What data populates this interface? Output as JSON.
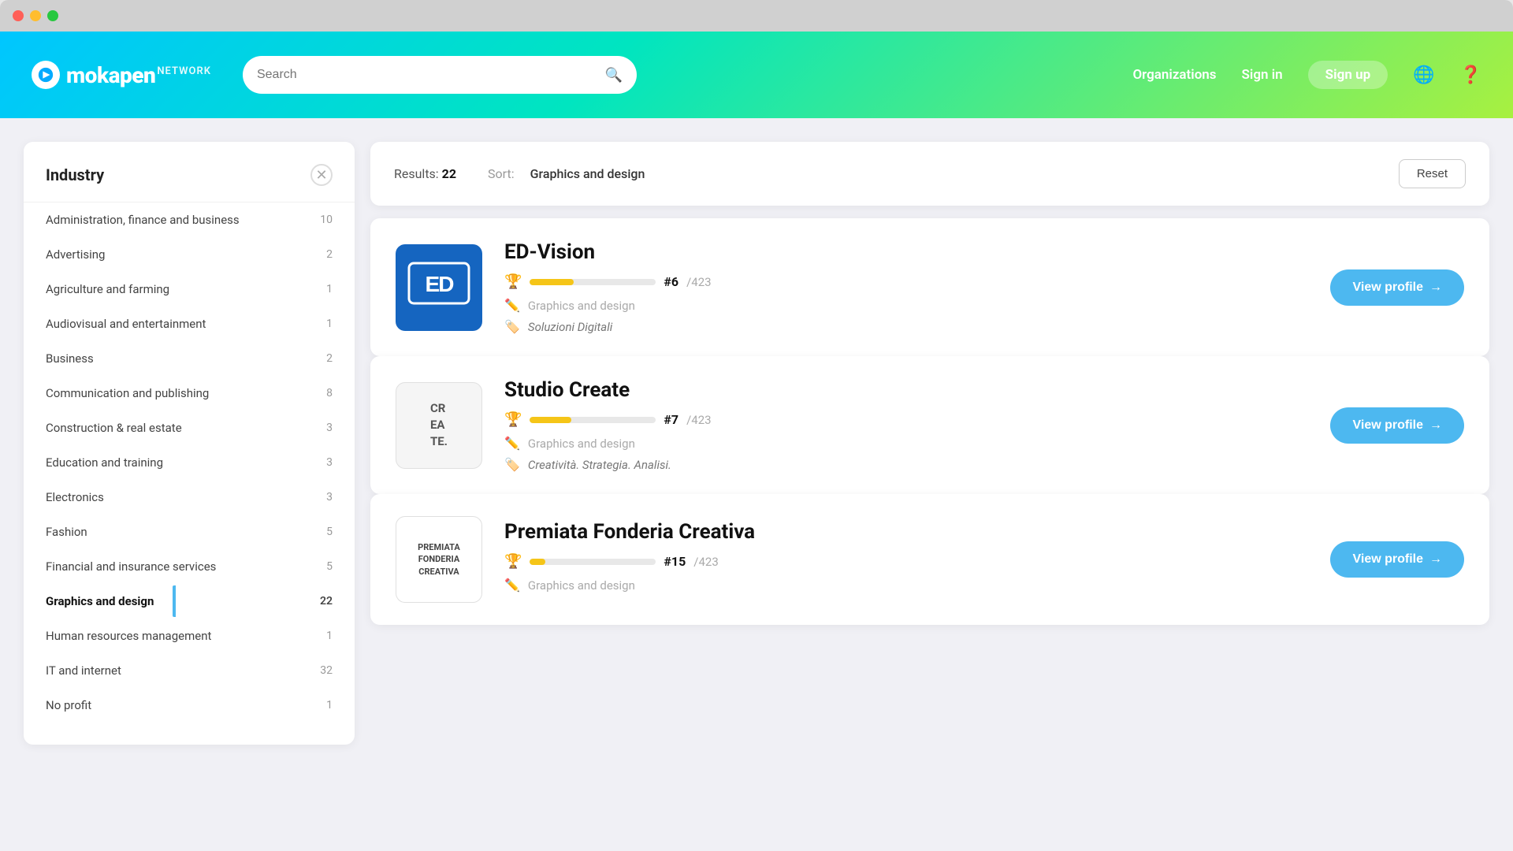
{
  "window": {
    "title": "Mokapen Network"
  },
  "header": {
    "logo_name": "mokapenNETWORK",
    "search_placeholder": "Search",
    "nav": {
      "organizations": "Organizations",
      "sign_in": "Sign in",
      "sign_up": "Sign up"
    }
  },
  "sidebar": {
    "title": "Industry",
    "items": [
      {
        "label": "Administration, finance and business",
        "count": "10",
        "active": false
      },
      {
        "label": "Advertising",
        "count": "2",
        "active": false
      },
      {
        "label": "Agriculture and farming",
        "count": "1",
        "active": false
      },
      {
        "label": "Audiovisual and entertainment",
        "count": "1",
        "active": false
      },
      {
        "label": "Business",
        "count": "2",
        "active": false
      },
      {
        "label": "Communication and publishing",
        "count": "8",
        "active": false
      },
      {
        "label": "Construction & real estate",
        "count": "3",
        "active": false
      },
      {
        "label": "Education and training",
        "count": "3",
        "active": false
      },
      {
        "label": "Electronics",
        "count": "3",
        "active": false
      },
      {
        "label": "Fashion",
        "count": "5",
        "active": false
      },
      {
        "label": "Financial and insurance services",
        "count": "5",
        "active": false
      },
      {
        "label": "Graphics and design",
        "count": "22",
        "active": true
      },
      {
        "label": "Human resources management",
        "count": "1",
        "active": false
      },
      {
        "label": "IT and internet",
        "count": "32",
        "active": false
      },
      {
        "label": "No profit",
        "count": "1",
        "active": false
      }
    ]
  },
  "results": {
    "label": "Results:",
    "count": "22",
    "sort_label": "Sort:",
    "sort_value": "Graphics and design",
    "reset_label": "Reset"
  },
  "profiles": [
    {
      "id": "ed-vision",
      "name": "ED-Vision",
      "logo_type": "blue",
      "logo_text": "ED",
      "rank_number": "#6",
      "rank_total": "/423",
      "rank_fill": "35%",
      "category": "Graphics and design",
      "tag": "Soluzioni Digitali",
      "view_profile_label": "View profile"
    },
    {
      "id": "studio-create",
      "name": "Studio Create",
      "logo_type": "gray",
      "logo_text": "CR\nEA\nTE.",
      "rank_number": "#7",
      "rank_total": "/423",
      "rank_fill": "33%",
      "category": "Graphics and design",
      "tag": "Creatività. Strategia. Analisi.",
      "view_profile_label": "View profile"
    },
    {
      "id": "premiata-fonderia-creativa",
      "name": "Premiata Fonderia Creativa",
      "logo_type": "white-outline",
      "logo_text": "PREMIATA\nFONDERIA\nCREATIVA",
      "rank_number": "#15",
      "rank_total": "/423",
      "rank_fill": "12%",
      "category": "Graphics and design",
      "tag": "",
      "view_profile_label": "View profile"
    }
  ]
}
